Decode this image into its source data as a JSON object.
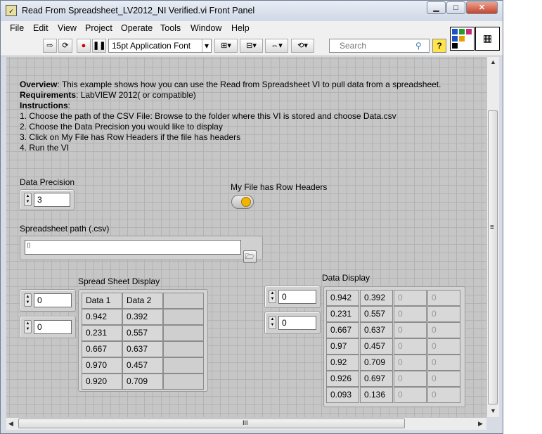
{
  "window": {
    "title": "Read From Spreadsheet_LV2012_NI Verified.vi Front Panel",
    "min_label": "▁",
    "max_label": "□",
    "close_label": "✕"
  },
  "menu": [
    "File",
    "Edit",
    "View",
    "Project",
    "Operate",
    "Tools",
    "Window",
    "Help"
  ],
  "toolbar": {
    "font_value": "15pt Application Font",
    "search_placeholder": "Search"
  },
  "overview": {
    "line1_bold": "Overview",
    "line1_rest": ": This example shows how you can use the Read from Spreadsheet VI to pull data from a spreadsheet.",
    "line2_bold": "Requirements",
    "line2_rest": ": LabVIEW 2012( or compatible)",
    "line3_bold": "Instructions",
    "line3_rest": ":",
    "steps": [
      "1. Choose the path of the CSV File: Browse to the folder where this VI is stored and choose Data.csv",
      "2. Choose the Data Precision you would like to display",
      "3. Click on My File has Row Headers if the file has headers",
      "4. Run the VI"
    ]
  },
  "data_precision": {
    "label": "Data Precision",
    "value": "3"
  },
  "row_headers": {
    "label": "My File has Row Headers",
    "state": "on"
  },
  "spreadsheet_path": {
    "label": "Spreadsheet path (.csv)",
    "value": ""
  },
  "spreadsheet_display": {
    "label": "Spread Sheet Display",
    "index_row": "0",
    "index_col": "0",
    "rows": [
      [
        "Data 1",
        "Data 2"
      ],
      [
        "0.942",
        "0.392"
      ],
      [
        "0.231",
        "0.557"
      ],
      [
        "0.667",
        "0.637"
      ],
      [
        "0.970",
        "0.457"
      ],
      [
        "0.920",
        "0.709"
      ]
    ]
  },
  "data_display": {
    "label": "Data Display",
    "index_row": "0",
    "index_col": "0",
    "rows": [
      [
        "0.942",
        "0.392",
        "0",
        "0"
      ],
      [
        "0.231",
        "0.557",
        "0",
        "0"
      ],
      [
        "0.667",
        "0.637",
        "0",
        "0"
      ],
      [
        "0.97",
        "0.457",
        "0",
        "0"
      ],
      [
        "0.92",
        "0.709",
        "0",
        "0"
      ],
      [
        "0.926",
        "0.697",
        "0",
        "0"
      ],
      [
        "0.093",
        "0.136",
        "0",
        "0"
      ]
    ]
  },
  "scroll": {
    "h_grip": "III",
    "v_grip": "≡"
  }
}
